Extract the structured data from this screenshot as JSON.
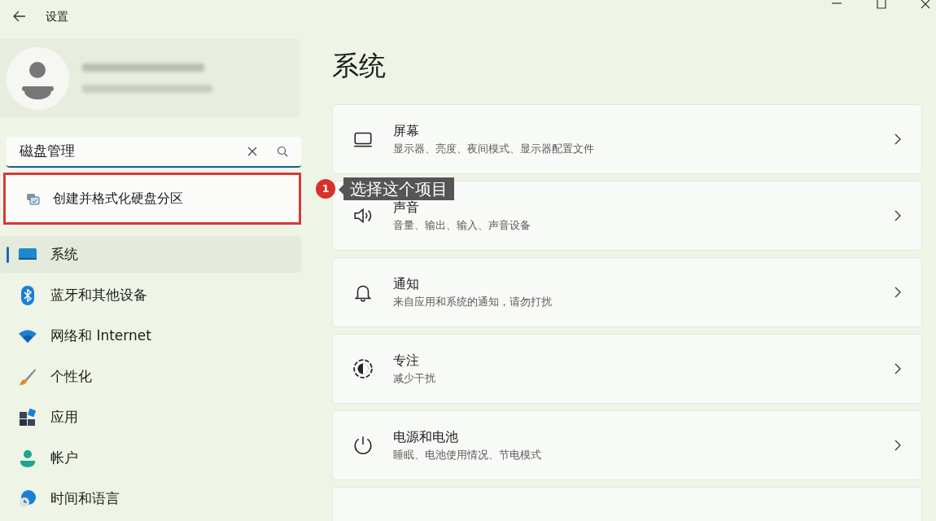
{
  "window": {
    "title": "设置"
  },
  "search": {
    "value": "磁盘管理",
    "results": [
      {
        "label": "创建并格式化硬盘分区",
        "highlighted": true
      }
    ]
  },
  "callout": {
    "number": "1",
    "text": "选择这个项目"
  },
  "sidebar": {
    "items": [
      {
        "label": "系统",
        "selected": true
      },
      {
        "label": "蓝牙和其他设备",
        "selected": false
      },
      {
        "label": "网络和 Internet",
        "selected": false
      },
      {
        "label": "个性化",
        "selected": false
      },
      {
        "label": "应用",
        "selected": false
      },
      {
        "label": "帐户",
        "selected": false
      },
      {
        "label": "时间和语言",
        "selected": false
      }
    ]
  },
  "page": {
    "title": "系统",
    "cards": [
      {
        "title": "屏幕",
        "subtitle": "显示器、亮度、夜间模式、显示器配置文件"
      },
      {
        "title": "声音",
        "subtitle": "音量、输出、输入、声音设备"
      },
      {
        "title": "通知",
        "subtitle": "来自应用和系统的通知，请勿打扰"
      },
      {
        "title": "专注",
        "subtitle": "减少干扰"
      },
      {
        "title": "电源和电池",
        "subtitle": "睡眠、电池使用情况、节电模式"
      }
    ]
  }
}
